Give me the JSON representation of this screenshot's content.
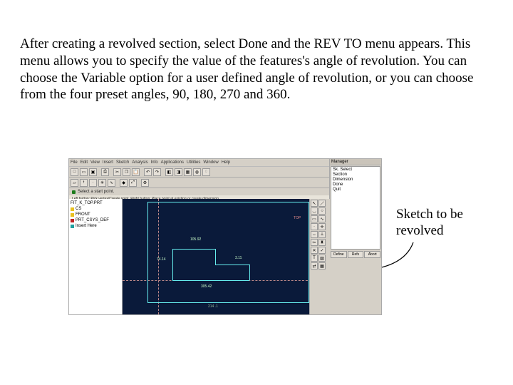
{
  "instruction_text": "After creating a revolved section, select Done and the REV TO menu appears. This menu allows you to specify the value of the features's angle of revolution. You can choose the Variable option for a user defined angle of revolution, or you can choose from the four preset angles, 90, 180, 270 and 360.",
  "annotation_text": "Sketch to be revolved",
  "menubar": [
    "File",
    "Edit",
    "View",
    "Insert",
    "Sketch",
    "Analysis",
    "Info",
    "Applications",
    "Utilities",
    "Window",
    "Help"
  ],
  "statusbar_text": "Select a start point.",
  "hint_bar_text": "Left button: Pick vertex/Create point.  Right button: Place point at existing or create dimension.",
  "right_panel": {
    "title": "Manager",
    "items": [
      "Sk. Select",
      "Section",
      "Dimension",
      "Done",
      "Quit"
    ],
    "buttons": [
      "Define",
      "Refs",
      "Abort"
    ]
  },
  "model_tree": {
    "root": "FIT_K_TOP.PRT",
    "items": [
      {
        "icon": "yellow",
        "label": "CS"
      },
      {
        "icon": "red",
        "label": "FRONT"
      },
      {
        "icon": "red",
        "label": "PRT_CSYS_DEF"
      },
      {
        "icon": "cyan",
        "label": "Insert Here"
      }
    ]
  },
  "sketch": {
    "dim_top": "105.92",
    "dim_left": "74.14",
    "dim_bottom": "305.42",
    "dim_right": "3.11",
    "axis_label": "TOP",
    "center_label": "214 .1"
  },
  "toolbar_icons": [
    "new",
    "open",
    "save",
    "sep",
    "print",
    "sep",
    "cut",
    "copy",
    "paste",
    "sep",
    "undo",
    "redo",
    "sep",
    "zoom",
    "pan",
    "rotate",
    "sep",
    "sketch",
    "dim",
    "constr"
  ],
  "toolstrip_icons": [
    "select",
    "line",
    "arc",
    "circle",
    "rect",
    "spline",
    "point",
    "coord",
    "dim",
    "constr",
    "trim",
    "mirror",
    "del",
    "done",
    "text",
    "fill",
    "toggle",
    "grid"
  ]
}
